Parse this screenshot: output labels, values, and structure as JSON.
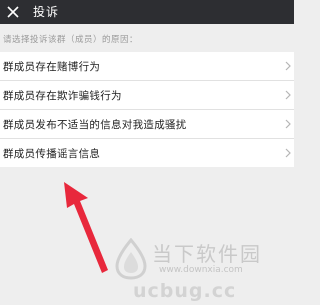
{
  "header": {
    "close_icon": "close-icon",
    "title": "投诉"
  },
  "hint": "请选择投诉该群（成员）的原因：",
  "reasons": [
    {
      "label": "群成员存在赌博行为"
    },
    {
      "label": "群成员存在欺诈骗钱行为"
    },
    {
      "label": "群成员发布不适当的信息对我造成骚扰"
    },
    {
      "label": "群成员传播谣言信息"
    }
  ],
  "annotation": {
    "arrow_color": "#e8283c"
  },
  "watermark": {
    "brand": "当下软件园",
    "url": "www.downxia.com",
    "alt": "ucbug.cc"
  },
  "colors": {
    "topbar": "#2d2e32",
    "background": "#eeeeee",
    "list": "#ffffff"
  }
}
